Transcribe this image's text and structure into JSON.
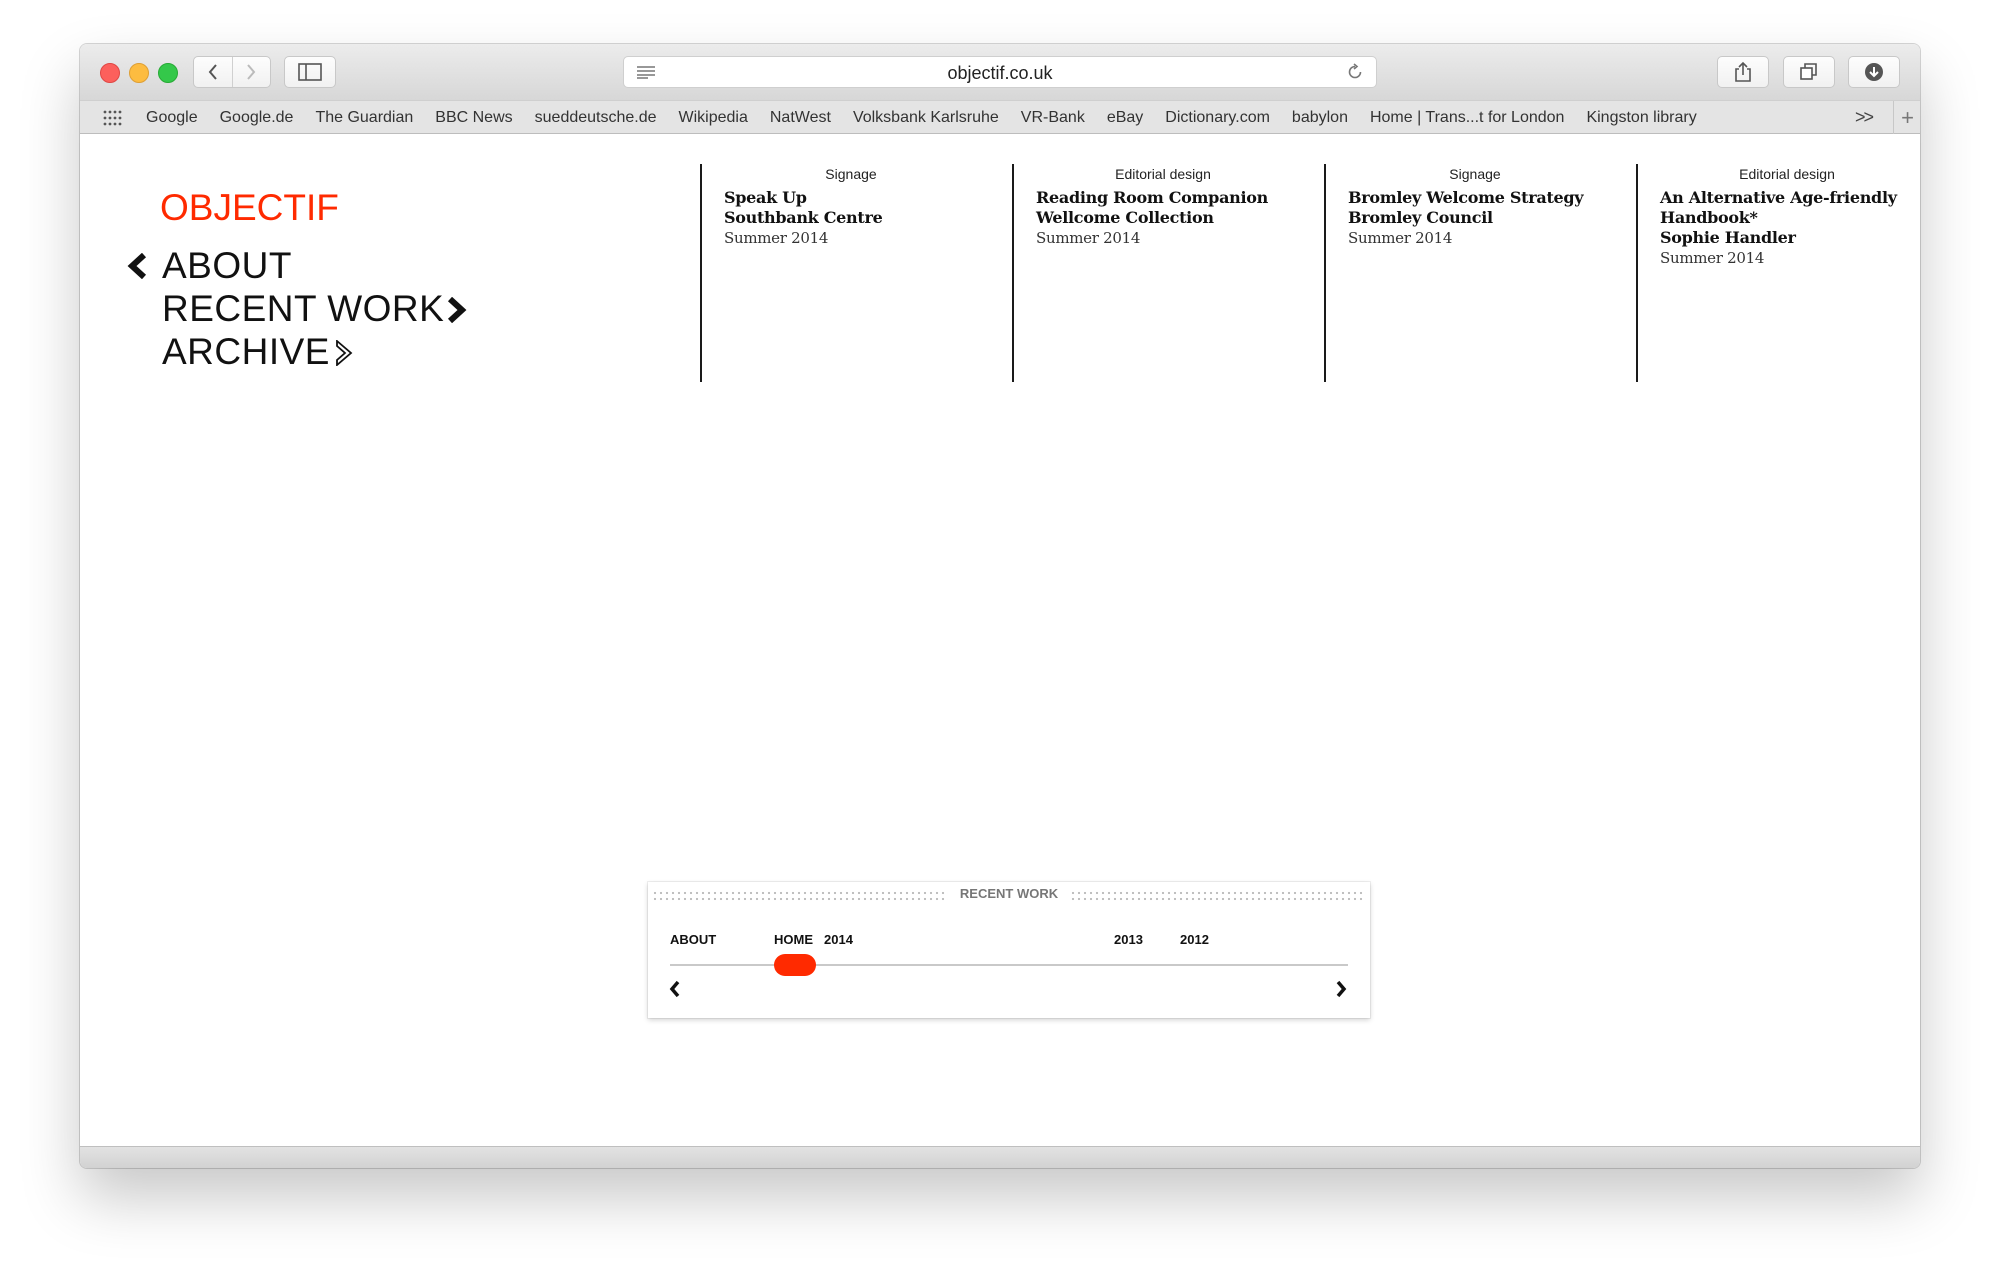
{
  "browser": {
    "url": "objectif.co.uk",
    "bookmarks": [
      "Google",
      "Google.de",
      "The Guardian",
      "BBC News",
      "sueddeutsche.de",
      "Wikipedia",
      "NatWest",
      "Volksbank Karlsruhe",
      "VR-Bank",
      "eBay",
      "Dictionary.com",
      "babylon",
      "Home | Trans...t for London",
      "Kingston library"
    ],
    "bookmarks_more": ">>",
    "bookmarks_add": "+"
  },
  "site": {
    "logo": "OBJECTIF",
    "accent_color": "#ff2a00",
    "menu": {
      "about": "ABOUT",
      "recent_work": "RECENT WORK",
      "archive": "ARCHIVE"
    }
  },
  "projects": [
    {
      "category": "Signage",
      "lines": [
        "Speak Up",
        "Southbank Centre"
      ],
      "date": "Summer 2014"
    },
    {
      "category": "Editorial design",
      "lines": [
        "Reading Room Companion",
        "Wellcome Collection"
      ],
      "date": "Summer 2014"
    },
    {
      "category": "Signage",
      "lines": [
        "Bromley Welcome Strategy",
        "Bromley Council"
      ],
      "date": "Summer 2014"
    },
    {
      "category": "Editorial design",
      "lines": [
        "An Alternative Age-friendly",
        "Handbook*",
        "Sophie Handler"
      ],
      "date": "Summer 2014"
    }
  ],
  "timeline": {
    "title": "RECENT WORK",
    "labels": {
      "about": "ABOUT",
      "home": "HOME",
      "y2014": "2014",
      "y2013": "2013",
      "y2012": "2012"
    }
  }
}
